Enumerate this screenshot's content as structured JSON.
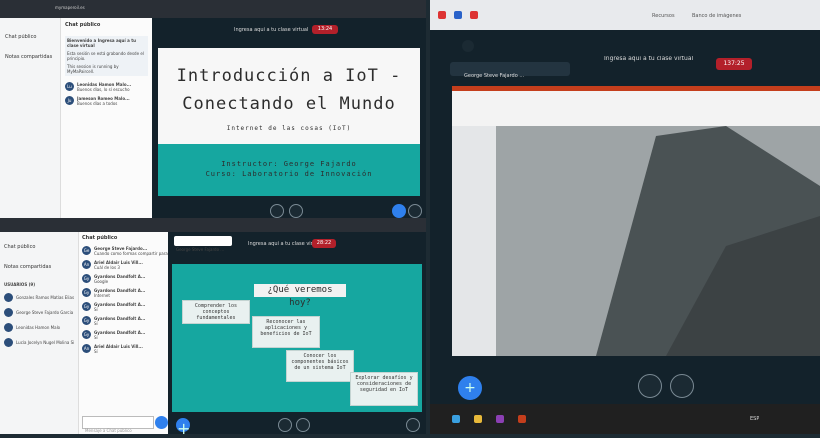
{
  "q1": {
    "url": "mymaperoil.es",
    "chat_header": "Chat público",
    "sidebar_items": [
      "Chat público",
      "Notas compartidas"
    ],
    "chat_intro": [
      "Bienvenido a Ingresa aquí a tu clase virtual",
      "Esta sesión se está grabando desde el principio.",
      "This session is running by MyMaPaircell."
    ],
    "messages": [
      {
        "initials": "Lu",
        "name": "Leonidas Hamon Malo...",
        "text": "Buenos días, lo sí escucho"
      },
      {
        "initials": "Ju",
        "name": "Jameson Romeo Malo...",
        "text": "Buenos días a todos"
      }
    ],
    "meeting_title": "Ingresa aquí a tu clase virtual",
    "rec_time": "13:24",
    "slide": {
      "title_line1": "Introducción a IoT -",
      "title_line2": "Conectando el Mundo",
      "subtitle": "Internet de las cosas (IoT)",
      "instructor": "Instructor: George Fajardo",
      "course": "Curso: Laboratorio de Innovación"
    }
  },
  "q2": {
    "chat_header": "Chat público",
    "sidebar_items": [
      "Chat público",
      "Notas compartidas"
    ],
    "users_label": "USUARIOS (9)",
    "users": [
      "Gonzales Ramos Matías Elias (Usted)",
      "George Steve Fajardo Garcia",
      "Leonidas Hamon Malo",
      "Lucía Jocelyn Nugel Molina Silva"
    ],
    "messages": [
      {
        "initials": "Ge",
        "name": "George Steve Fajardo...",
        "text": "Cuando como formas compartir para resguardar datos"
      },
      {
        "initials": "An",
        "name": "Ariel Aldair Luis Vill...",
        "text": "Cuál de los 3"
      },
      {
        "initials": "Gy",
        "name": "Gyardons Dandfolt A...",
        "text": "Google"
      },
      {
        "initials": "Gy",
        "name": "Gyardons Dandfolt A...",
        "text": "Internet"
      },
      {
        "initials": "Gy",
        "name": "Gyardons Dandfolt A...",
        "text": "Sí"
      },
      {
        "initials": "Gy",
        "name": "Gyardons Dandfolt A...",
        "text": "Sí"
      },
      {
        "initials": "Gy",
        "name": "Gyardons Dandfolt A...",
        "text": "Sí"
      },
      {
        "initials": "An",
        "name": "Ariel Aldair Luis Vill...",
        "text": "Sí"
      }
    ],
    "input_placeholder": "Mensaje a Chat público",
    "presenter": "George Steve Fajardo ...",
    "meeting_title": "Ingresa aquí a tu clase virtual",
    "rec_time": "28:22",
    "slide": {
      "title": "¿Qué veremos hoy?",
      "items": [
        "Comprender los conceptos fundamentales",
        "Reconocer las aplicaciones y beneficios de IoT",
        "Conocer los componentes básicos de un sistema IoT",
        "Explorar desafíos y consideraciones de seguridad en IoT"
      ]
    }
  },
  "q3": {
    "presenter": "George Steve Fajardo ...",
    "meeting_title": "Ingresa aquí a tu clase virtual",
    "rec_time": "137:25",
    "bookmarks": [
      "Recursos",
      "Banco de imágenes"
    ],
    "taskbar_lang": "ESP"
  },
  "colors": {
    "teal": "#16a7a0",
    "record_red": "#b3202a",
    "bbb_dark": "#13222b",
    "action_blue": "#2f80ed"
  }
}
